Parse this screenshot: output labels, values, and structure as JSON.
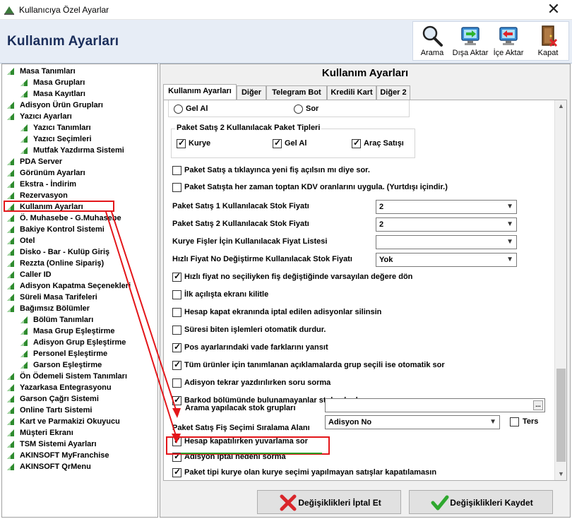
{
  "window": {
    "title": "Kullanıcıya Özel Ayarlar",
    "close_glyph": "✕"
  },
  "header": {
    "title": "Kullanım Ayarları"
  },
  "toolbar": [
    {
      "label": "Arama",
      "icon": "magnifier-icon"
    },
    {
      "label": "Dışa Aktar",
      "icon": "export-monitor-icon"
    },
    {
      "label": "İçe Aktar",
      "icon": "import-monitor-icon"
    },
    {
      "label": "Kapat",
      "icon": "exit-door-icon"
    }
  ],
  "tree": [
    {
      "label": "Masa Tanımları",
      "level": 0
    },
    {
      "label": "Masa Grupları",
      "level": 1
    },
    {
      "label": "Masa Kayıtları",
      "level": 1
    },
    {
      "label": "Adisyon Ürün Grupları",
      "level": 0
    },
    {
      "label": "Yazıcı Ayarları",
      "level": 0
    },
    {
      "label": "Yazıcı Tanımları",
      "level": 1
    },
    {
      "label": "Yazıcı Seçimleri",
      "level": 1
    },
    {
      "label": "Mutfak Yazdırma Sistemi",
      "level": 1
    },
    {
      "label": "PDA Server",
      "level": 0
    },
    {
      "label": "Görünüm Ayarları",
      "level": 0
    },
    {
      "label": "Ekstra - İndirim",
      "level": 0
    },
    {
      "label": "Rezervasyon",
      "level": 0
    },
    {
      "label": "Kullanım Ayarları",
      "level": 0,
      "selected": true
    },
    {
      "label": "Ö. Muhasebe - G.Muhasebe",
      "level": 0
    },
    {
      "label": "Bakiye Kontrol Sistemi",
      "level": 0
    },
    {
      "label": "Otel",
      "level": 0
    },
    {
      "label": "Disko - Bar - Kulüp Giriş",
      "level": 0
    },
    {
      "label": "Rezzta (Online Sipariş)",
      "level": 0
    },
    {
      "label": "Caller ID",
      "level": 0
    },
    {
      "label": "Adisyon Kapatma Seçenekleri",
      "level": 0
    },
    {
      "label": "Süreli Masa Tarifeleri",
      "level": 0
    },
    {
      "label": "Bağımsız Bölümler",
      "level": 0
    },
    {
      "label": "Bölüm Tanımları",
      "level": 1
    },
    {
      "label": "Masa Grup Eşleştirme",
      "level": 1
    },
    {
      "label": "Adisyon Grup Eşleştirme",
      "level": 1
    },
    {
      "label": "Personel Eşleştirme",
      "level": 1
    },
    {
      "label": "Garson Eşleştirme",
      "level": 1
    },
    {
      "label": "Ön Ödemeli Sistem Tanımları",
      "level": 0
    },
    {
      "label": "Yazarkasa Entegrasyonu",
      "level": 0
    },
    {
      "label": "Garson Çağrı Sistemi",
      "level": 0
    },
    {
      "label": "Online Tartı Sistemi",
      "level": 0
    },
    {
      "label": "Kart ve Parmakizi Okuyucu",
      "level": 0
    },
    {
      "label": "Müşteri Ekranı",
      "level": 0
    },
    {
      "label": "TSM Sistemi Ayarları",
      "level": 0
    },
    {
      "label": "AKINSOFT MyFranchise",
      "level": 0
    },
    {
      "label": "AKINSOFT QrMenu",
      "level": 0
    }
  ],
  "panel": {
    "title": "Kullanım Ayarları",
    "tabs": [
      "Kullanım Ayarları",
      "Diğer",
      "Telegram Bot",
      "Kredili Kart",
      "Diğer 2"
    ],
    "radios": [
      {
        "label": "Gel Al"
      },
      {
        "label": "Sor"
      }
    ],
    "package_group": {
      "title": "Paket Satış 2 Kullanılacak Paket Tipleri",
      "items": [
        {
          "label": "Kurye",
          "checked": true
        },
        {
          "label": "Gel Al",
          "checked": true
        },
        {
          "label": "Araç Satışı",
          "checked": true
        }
      ]
    },
    "checks_top": [
      {
        "label": "Paket Satış a tıklayınca yeni fiş açılsın mı diye sor.",
        "checked": false
      },
      {
        "label": "Paket Satışta her zaman toptan KDV oranlarını uygula. (Yurtdışı içindir.)",
        "checked": false
      }
    ],
    "combos": [
      {
        "label": "Paket Satış 1 Kullanılacak Stok Fiyatı",
        "value": "2"
      },
      {
        "label": "Paket Satış 2 Kullanılacak Stok Fiyatı",
        "value": "2"
      },
      {
        "label": "Kurye Fişler İçin Kullanılacak Fiyat Listesi",
        "value": ""
      },
      {
        "label": "Hızlı Fiyat No Değiştirme Kullanılacak Stok Fiyatı",
        "value": "Yok"
      }
    ],
    "checks_mid": [
      {
        "label": "Hızlı fiyat no seçiliyken fiş değiştiğinde varsayılan değere dön",
        "checked": true
      },
      {
        "label": "İlk açılışta ekranı kilitle",
        "checked": false
      },
      {
        "label": "Hesap kapat ekranında iptal edilen adisyonlar silinsin",
        "checked": false
      },
      {
        "label": "Süresi biten işlemleri otomatik durdur.",
        "checked": false
      },
      {
        "label": "Pos ayarlarındaki vade farklarını yansıt",
        "checked": true
      },
      {
        "label": "Tüm ürünler için tanımlanan açıklamalarda grup seçili ise otomatik sor",
        "checked": true
      },
      {
        "label": "Adisyon tekrar yazdırılırken soru sorma",
        "checked": false
      },
      {
        "label": "Barkod bölümünde bulunamayanlar stok adında aransın",
        "checked": true
      }
    ],
    "stock_groups": {
      "label": "Arama yapılacak stok grupları",
      "value": "",
      "button": "..."
    },
    "sort_row": {
      "label": "Paket Satış Fiş Seçimi Sıralama Alanı",
      "value": "Adisyon No",
      "reverse_label": "Ters",
      "reverse_checked": false
    },
    "checks_bottom": [
      {
        "label": "Hesap kapatılırken yuvarlama sor",
        "checked": true
      },
      {
        "label": "Adisyon iptal nedeni sorma",
        "checked": true
      },
      {
        "label": "Paket tipi kurye olan kurye seçimi yapılmayan satışlar kapatılamasın",
        "checked": true
      }
    ],
    "buttons": {
      "cancel": "Değişiklikleri İptal Et",
      "save": "Değişiklikleri Kaydet"
    }
  },
  "colors": {
    "annotation_red": "#e3161a",
    "underline_green": "#2aa02a",
    "header_text": "#1a2d5a",
    "leaf_green": "#2e8b2e"
  }
}
